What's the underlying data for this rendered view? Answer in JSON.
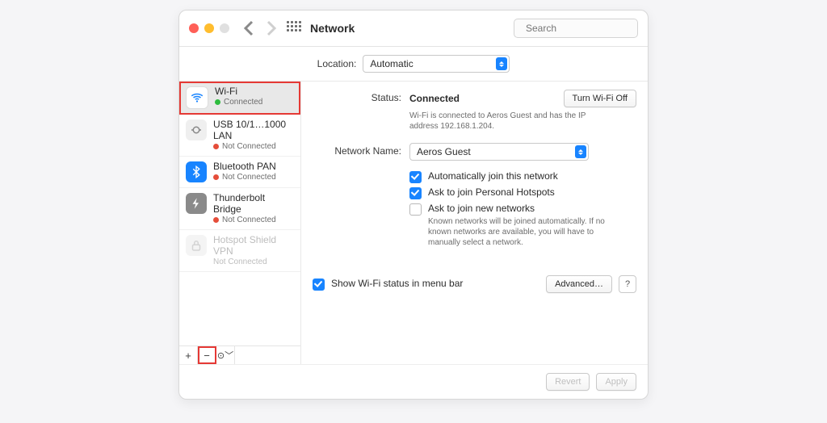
{
  "toolbar": {
    "title": "Network",
    "search_placeholder": "Search"
  },
  "location": {
    "label": "Location:",
    "value": "Automatic"
  },
  "services": [
    {
      "name": "Wi-Fi",
      "status": "Connected",
      "dot": "green"
    },
    {
      "name": "USB 10/1…1000 LAN",
      "status": "Not Connected",
      "dot": "red"
    },
    {
      "name": "Bluetooth PAN",
      "status": "Not Connected",
      "dot": "red"
    },
    {
      "name": "Thunderbolt Bridge",
      "status": "Not Connected",
      "dot": "red"
    },
    {
      "name": "Hotspot Shield VPN",
      "status": "Not Connected",
      "dot": "none"
    }
  ],
  "main": {
    "status_label": "Status:",
    "status_value": "Connected",
    "turn_off": "Turn Wi-Fi Off",
    "status_detail": "Wi-Fi is connected to Aeros Guest and has the IP address 192.168.1.204.",
    "netname_label": "Network Name:",
    "netname_value": "Aeros Guest",
    "chk_auto": "Automatically join this network",
    "chk_hotspot": "Ask to join Personal Hotspots",
    "chk_new": "Ask to join new networks",
    "chk_new_detail": "Known networks will be joined automatically. If no known networks are available, you will have to manually select a network.",
    "menu_bar": "Show Wi-Fi status in menu bar",
    "advanced": "Advanced…",
    "help": "?",
    "revert": "Revert",
    "apply": "Apply"
  },
  "sidefoot": {
    "plus": "+",
    "minus": "−",
    "gear": "⊙﹀"
  }
}
